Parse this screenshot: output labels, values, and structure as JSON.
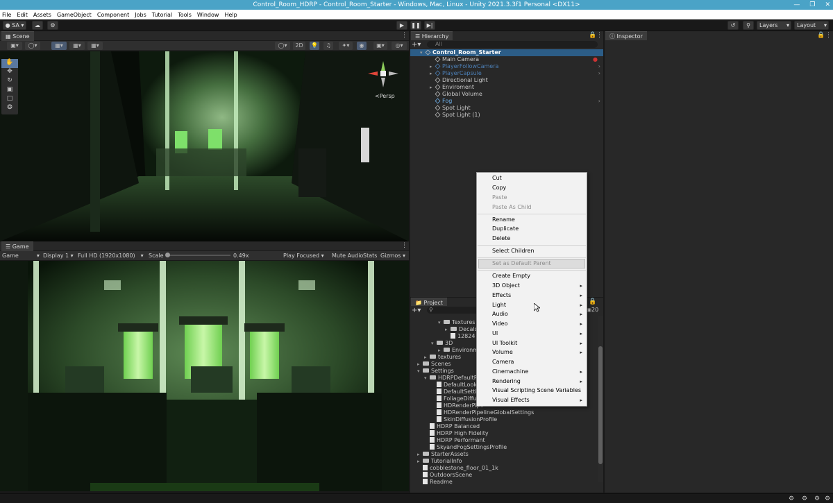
{
  "window": {
    "title": "Control_Room_HDRP - Control_Room_Starter - Windows, Mac, Linux - Unity 2021.3.3f1 Personal <DX11>"
  },
  "menu": [
    "File",
    "Edit",
    "Assets",
    "GameObject",
    "Component",
    "Jobs",
    "Tutorial",
    "Tools",
    "Window",
    "Help"
  ],
  "toolbar": {
    "account": "SA",
    "layers": "Layers",
    "layout": "Layout"
  },
  "scene": {
    "tab": "Scene",
    "mode_2d": "2D",
    "persp": "Persp"
  },
  "game": {
    "tab": "Game",
    "view": "Game",
    "display": "Display 1",
    "resolution": "Full HD (1920x1080)",
    "scale_label": "Scale",
    "scale_value": "0.49x",
    "play_focused": "Play Focused",
    "mute": "Mute Audio",
    "stats": "Stats",
    "gizmos": "Gizmos"
  },
  "hierarchy": {
    "tab": "Hierarchy",
    "search_placeholder": "All",
    "root": "Control_Room_Starter",
    "items": [
      {
        "label": "Main Camera",
        "style": "normal"
      },
      {
        "label": "PlayerFollowCamera",
        "style": "prefab-dim"
      },
      {
        "label": "PlayerCapsule",
        "style": "prefab-dim"
      },
      {
        "label": "Directional Light",
        "style": "normal"
      },
      {
        "label": "Enviroment",
        "style": "normal"
      },
      {
        "label": "Global Volume",
        "style": "normal"
      },
      {
        "label": "Fog",
        "style": "prefab"
      },
      {
        "label": "Spot Light",
        "style": "normal"
      },
      {
        "label": "Spot Light (1)",
        "style": "normal"
      }
    ]
  },
  "inspector": {
    "tab": "Inspector"
  },
  "project": {
    "tab": "Project",
    "count": "20",
    "items": [
      {
        "label": "Textures",
        "kind": "folder",
        "depth": 3
      },
      {
        "label": "Decals",
        "kind": "folder",
        "depth": 4
      },
      {
        "label": "12824",
        "kind": "file",
        "depth": 4
      },
      {
        "label": "3D",
        "kind": "folder",
        "depth": 2
      },
      {
        "label": "Environmen",
        "kind": "folder",
        "depth": 3
      },
      {
        "label": "textures",
        "kind": "folder",
        "depth": 1
      },
      {
        "label": "Scenes",
        "kind": "folder",
        "depth": 0
      },
      {
        "label": "Settings",
        "kind": "folder",
        "depth": 0
      },
      {
        "label": "HDRPDefaultRes",
        "kind": "folder",
        "depth": 1
      },
      {
        "label": "DefaultLookD",
        "kind": "file",
        "depth": 2
      },
      {
        "label": "DefaultSetting",
        "kind": "file",
        "depth": 2
      },
      {
        "label": "FoliageDiffusi",
        "kind": "file",
        "depth": 2
      },
      {
        "label": "HDRenderPipe",
        "kind": "file",
        "depth": 2
      },
      {
        "label": "HDRenderPipelineGlobalSettings",
        "kind": "file",
        "depth": 2
      },
      {
        "label": "SkinDiffusionProfile",
        "kind": "file",
        "depth": 2
      },
      {
        "label": "HDRP Balanced",
        "kind": "file",
        "depth": 1
      },
      {
        "label": "HDRP High Fidelity",
        "kind": "file",
        "depth": 1
      },
      {
        "label": "HDRP Performant",
        "kind": "file",
        "depth": 1
      },
      {
        "label": "SkyandFogSettingsProfile",
        "kind": "file",
        "depth": 1
      },
      {
        "label": "StarterAssets",
        "kind": "folder",
        "depth": 0
      },
      {
        "label": "TutorialInfo",
        "kind": "folder",
        "depth": 0
      },
      {
        "label": "cobblestone_floor_01_1k",
        "kind": "file",
        "depth": 0
      },
      {
        "label": "OutdoorsScene",
        "kind": "file",
        "depth": 0
      },
      {
        "label": "Readme",
        "kind": "file",
        "depth": 0
      }
    ]
  },
  "context_menu": {
    "cut": "Cut",
    "copy": "Copy",
    "paste": "Paste",
    "paste_as_child": "Paste As Child",
    "rename": "Rename",
    "duplicate": "Duplicate",
    "delete": "Delete",
    "select_children": "Select Children",
    "set_default_parent": "Set as Default Parent",
    "create_empty": "Create Empty",
    "object3d": "3D Object",
    "effects": "Effects",
    "light": "Light",
    "audio": "Audio",
    "video": "Video",
    "ui": "UI",
    "ui_toolkit": "UI Toolkit",
    "volume": "Volume",
    "camera": "Camera",
    "cinemachine": "Cinemachine",
    "rendering": "Rendering",
    "visual_scripting": "Visual Scripting Scene Variables",
    "visual_effects": "Visual Effects"
  }
}
